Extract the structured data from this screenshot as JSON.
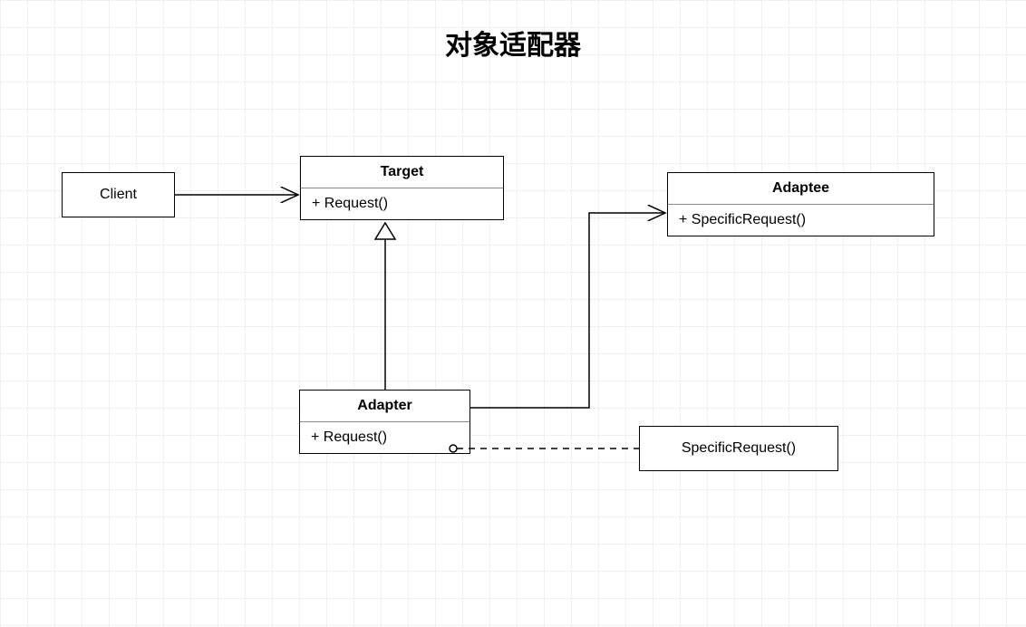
{
  "title": "对象适配器",
  "client": {
    "label": "Client"
  },
  "target": {
    "name": "Target",
    "method": "+ Request()"
  },
  "adaptee": {
    "name": "Adaptee",
    "method": "+ SpecificRequest()"
  },
  "adapter": {
    "name": "Adapter",
    "method": "+ Request()"
  },
  "note": {
    "label": "SpecificRequest()"
  }
}
